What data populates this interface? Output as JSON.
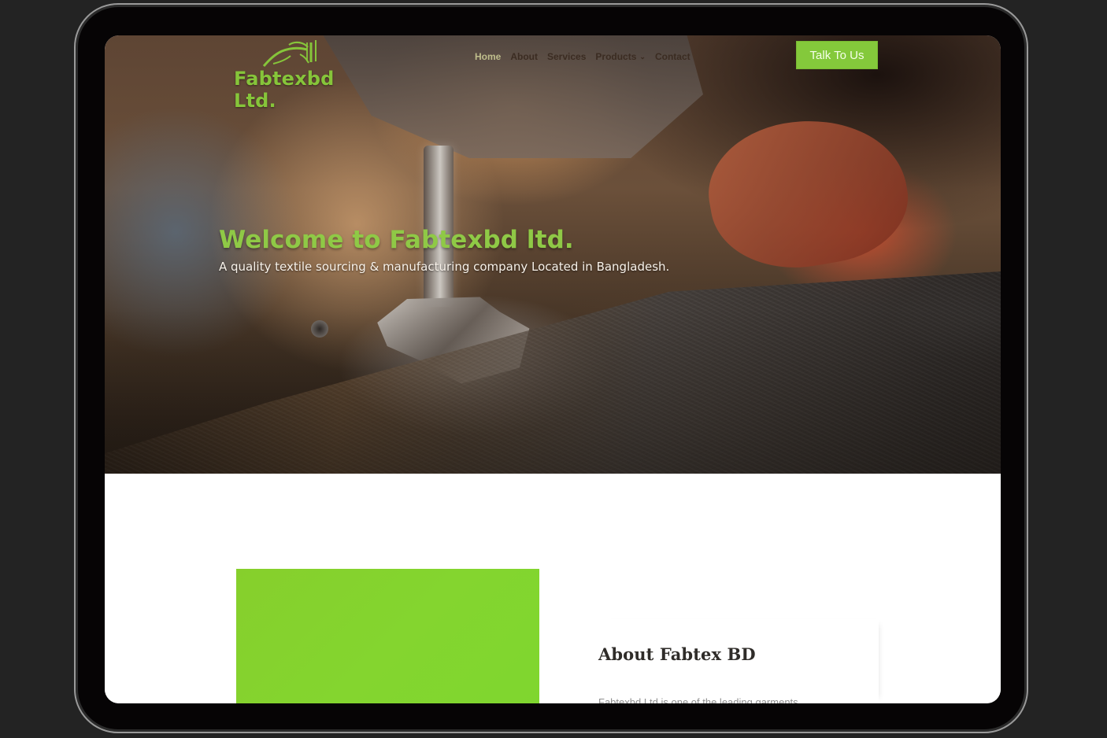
{
  "brand": {
    "name": "Fabtexbd Ltd.",
    "accent": "#86c53a"
  },
  "nav": {
    "items": [
      {
        "label": "Home",
        "active": true
      },
      {
        "label": "About",
        "active": false
      },
      {
        "label": "Services",
        "active": false
      },
      {
        "label": "Products",
        "active": false
      },
      {
        "label": "Contact",
        "active": false
      }
    ],
    "cta_label": "Talk To Us"
  },
  "hero": {
    "title": "Welcome to Fabtexbd ltd.",
    "subtitle": "A quality textile sourcing & manufacturing company Located in Bangladesh."
  },
  "about": {
    "title": "About Fabtex BD",
    "body": "Fabtexbd Ltd is one of the leading garments manufacturer in Bangladesh primarily dealing in textile and apparel sector."
  },
  "colors": {
    "device_bg": "#232323",
    "screen_bg": "#ffffff",
    "hero_title": "#8fc946",
    "cta_bg": "#84c93b",
    "image_block": "#84d52f"
  },
  "icons": {
    "logo": "sewing-machine-logo-icon",
    "dropdown": "chevron-down-icon"
  }
}
